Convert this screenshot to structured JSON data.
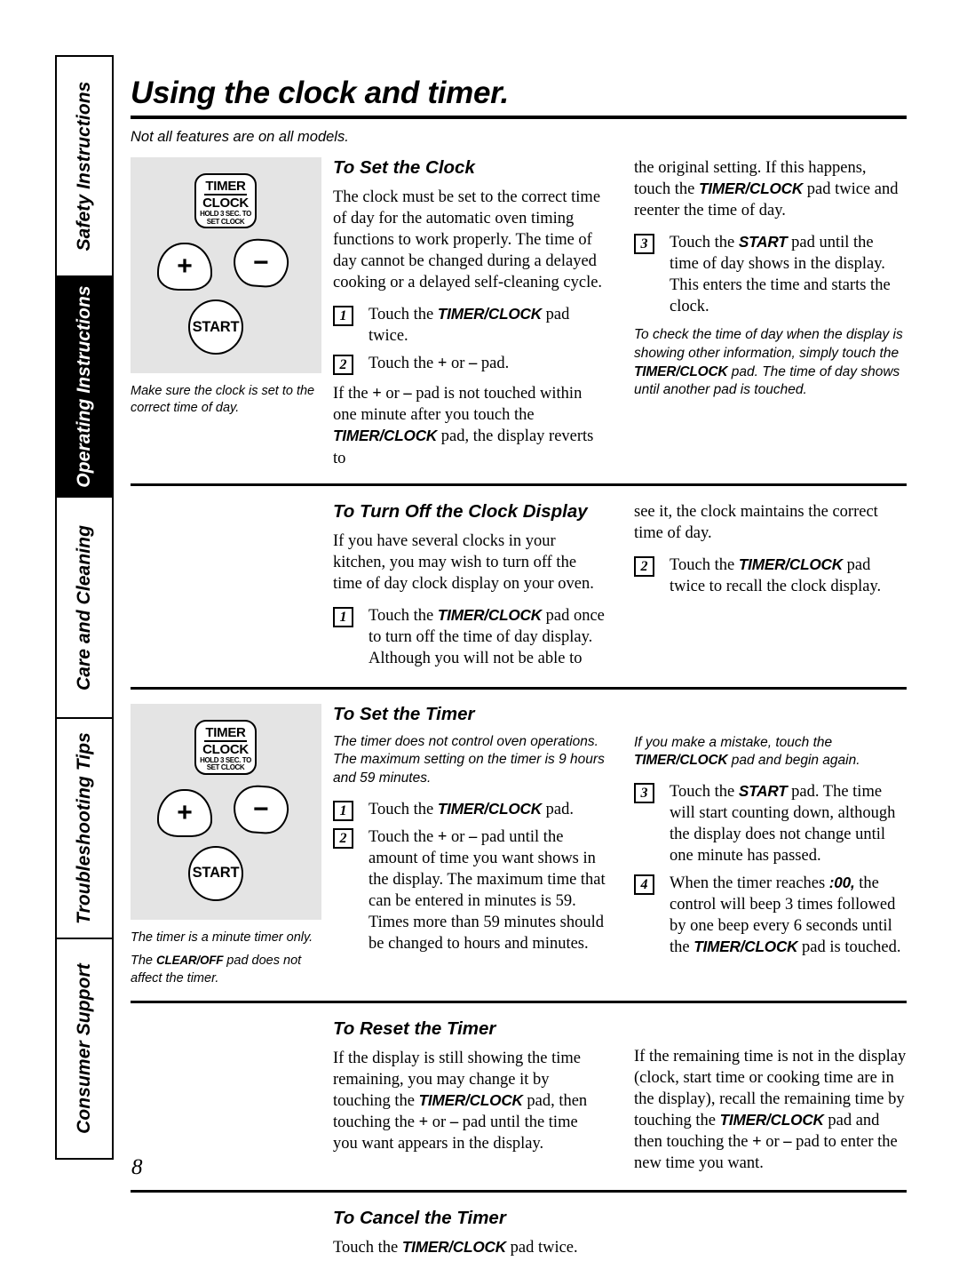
{
  "sidebar": {
    "tabs": [
      {
        "label": "Safety Instructions",
        "active": false
      },
      {
        "label": "Operating Instructions",
        "active": true
      },
      {
        "label": "Care and Cleaning",
        "active": false
      },
      {
        "label": "Troubleshooting Tips",
        "active": false
      },
      {
        "label": "Consumer Support",
        "active": false
      }
    ]
  },
  "header": {
    "title": "Using the clock and timer.",
    "subtitle": "Not all features are on all models."
  },
  "illustration": {
    "timer_pad_line1": "TIMER",
    "timer_pad_line2": "CLOCK",
    "timer_pad_line3a": "HOLD 3 SEC. TO",
    "timer_pad_line3b": "SET CLOCK",
    "plus_glyph": "+",
    "minus_glyph": "−",
    "start_label": "START"
  },
  "sections": {
    "set_clock": {
      "heading": "To Set the Clock",
      "intro": "The clock must be set to the correct time of day for the automatic oven timing functions to work properly. The time of day cannot be changed during a delayed cooking or a delayed self-cleaning cycle.",
      "step1_num": "1",
      "step1_a": "Touch the ",
      "step1_pad": "TIMER/CLOCK",
      "step1_b": " pad twice.",
      "step2_num": "2",
      "step2_a": "Touch the ",
      "step2_plus": "+",
      "step2_mid": " or ",
      "step2_minus": "–",
      "step2_b": " pad.",
      "after_a": "If the ",
      "after_plus": "+",
      "after_mid": " or ",
      "after_minus": "–",
      "after_b": " pad is not touched within one minute after you touch the ",
      "after_pad": "TIMER/CLOCK",
      "after_c": " pad, the display reverts to",
      "right_cont": "the original setting. If this happens, touch the ",
      "right_cont_pad": "TIMER/CLOCK",
      "right_cont_b": " pad twice and reenter the time of day.",
      "step3_num": "3",
      "step3_a": "Touch the ",
      "step3_pad": "START",
      "step3_b": " pad until the time of day shows in the display. This enters the time and starts the clock.",
      "note_a": "To check the time of day when the display is showing other information, simply touch the ",
      "note_pad": "TIMER/CLOCK",
      "note_b": " pad. The time of day shows until another pad is touched.",
      "caption": "Make sure the clock is set to the correct time of day."
    },
    "turn_off_display": {
      "heading": "To Turn Off the Clock Display",
      "intro": "If you have several clocks in your kitchen, you may wish to turn off the time of day clock display on your oven.",
      "step1_num": "1",
      "step1_a": "Touch the ",
      "step1_pad": "TIMER/CLOCK",
      "step1_b": " pad once to turn off the time of day display. Although you will not be able to",
      "right_cont": "see it, the clock maintains the correct time of day.",
      "step2_num": "2",
      "step2_a": "Touch the ",
      "step2_pad": "TIMER/CLOCK",
      "step2_b": " pad twice to recall the clock display."
    },
    "set_timer": {
      "heading": "To Set the Timer",
      "note_left": "The timer does not control oven operations. The maximum setting on the timer is 9 hours and 59 minutes.",
      "step1_num": "1",
      "step1_a": "Touch the ",
      "step1_pad": "TIMER/CLOCK",
      "step1_b": " pad.",
      "step2_num": "2",
      "step2_a": "Touch the ",
      "step2_plus": "+",
      "step2_mid": " or ",
      "step2_minus": "–",
      "step2_b": " pad until the amount of time you want shows in the display. The maximum time that can be entered in minutes is 59. Times more than 59 minutes should be changed to hours and minutes.",
      "note_right_a": "If you make a mistake, touch the ",
      "note_right_pad": "TIMER/CLOCK",
      "note_right_b": " pad and begin again.",
      "step3_num": "3",
      "step3_a": "Touch the ",
      "step3_pad": "START",
      "step3_b": " pad. The time will start counting down, although the display does not change until one minute has passed.",
      "step4_num": "4",
      "step4_a": "When the timer reaches ",
      "step4_value": ":00,",
      "step4_b": " the control will beep 3 times followed by one beep every 6 seconds until the ",
      "step4_pad": "TIMER/CLOCK",
      "step4_c": " pad is touched.",
      "caption1": "The timer is a minute timer only.",
      "caption2_a": "The ",
      "caption2_pad": "CLEAR/OFF",
      "caption2_b": " pad does not affect the timer."
    },
    "reset_timer": {
      "heading": "To Reset the Timer",
      "left_a": "If the display is still showing the time remaining, you may change it by touching the ",
      "left_pad": "TIMER/CLOCK",
      "left_b": " pad, then touching the ",
      "left_plus": "+",
      "left_mid": " or ",
      "left_minus": "–",
      "left_c": " pad until the time you want appears in the display.",
      "right_a": "If the remaining time is not in the display (clock, start time or cooking time are in the display), recall the remaining time by touching the ",
      "right_pad": "TIMER/CLOCK",
      "right_b": " pad and then touching the ",
      "right_plus": "+",
      "right_mid": " or ",
      "right_minus": "–",
      "right_c": " pad to enter the new time you want."
    },
    "cancel_timer": {
      "heading": "To Cancel the Timer",
      "body_a": "Touch the ",
      "body_pad": "TIMER/CLOCK",
      "body_b": " pad twice."
    }
  },
  "footer": {
    "page_number": "8"
  }
}
